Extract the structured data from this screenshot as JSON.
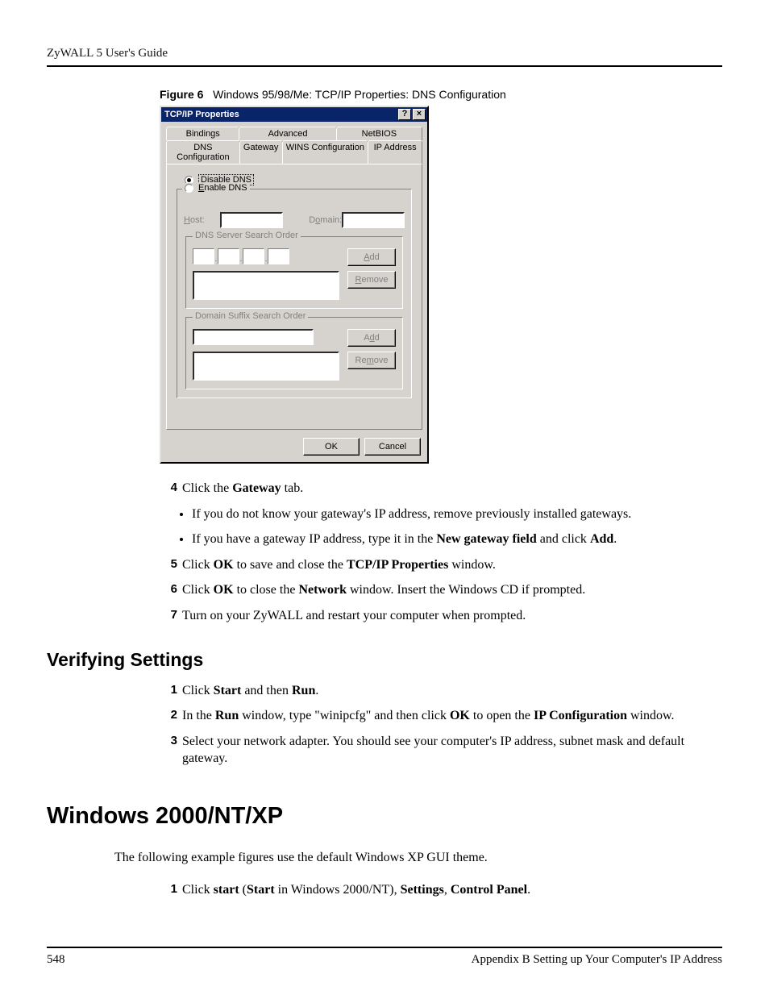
{
  "header": {
    "title": "ZyWALL 5 User's Guide"
  },
  "figure": {
    "label": "Figure 6",
    "caption": "Windows 95/98/Me: TCP/IP Properties: DNS Configuration"
  },
  "dialog": {
    "title": "TCP/IP Properties",
    "help_btn": "?",
    "close_btn": "×",
    "tabs_back": {
      "bindings": "Bindings",
      "advanced": "Advanced",
      "netbios": "NetBIOS"
    },
    "tabs_front": {
      "dns": "DNS Configuration",
      "gateway": "Gateway",
      "wins": "WINS Configuration",
      "ip": "IP Address"
    },
    "radio_disable": "Disable DNS",
    "radio_enable": "Enable DNS",
    "host_label": "Host:",
    "domain_label": "Domain:",
    "group_dns_servers": "DNS Server Search Order",
    "group_domain_suffix": "Domain Suffix Search Order",
    "btn_add": "Add",
    "btn_remove": "Remove",
    "btn_ok": "OK",
    "btn_cancel": "Cancel"
  },
  "steps1": {
    "n4": "4",
    "t4a": "Click the ",
    "t4b": "Gateway",
    "t4c": " tab.",
    "bullet1a": "If you do not know your gateway's IP address, remove previously installed gateways.",
    "bullet2a": "If you have a gateway IP address, type it in the ",
    "bullet2b": "New gateway field",
    "bullet2c": " and click ",
    "bullet2d": "Add",
    "bullet2e": ".",
    "n5": "5",
    "t5a": "Click ",
    "t5b": "OK",
    "t5c": " to save and close the ",
    "t5d": "TCP/IP Properties",
    "t5e": " window.",
    "n6": "6",
    "t6a": "Click ",
    "t6b": "OK",
    "t6c": " to close the ",
    "t6d": "Network",
    "t6e": " window. Insert the Windows CD if prompted.",
    "n7": "7",
    "t7": "Turn on your ZyWALL and restart your computer when prompted."
  },
  "section_verifying": "Verifying Settings",
  "steps2": {
    "n1": "1",
    "t1a": "Click ",
    "t1b": "Start",
    "t1c": " and then ",
    "t1d": "Run",
    "t1e": ".",
    "n2": "2",
    "t2a": "In the ",
    "t2b": "Run",
    "t2c": " window, type \"winipcfg\" and then click ",
    "t2d": "OK",
    "t2e": " to open the ",
    "t2f": "IP Configuration",
    "t2g": " window.",
    "n3": "3",
    "t3": "Select your network adapter. You should see your computer's IP address, subnet mask and default gateway."
  },
  "section_win2000": "Windows 2000/NT/XP",
  "para_win2000": "The following example figures use the default Windows XP GUI theme.",
  "steps3": {
    "n1": "1",
    "t1a": "Click ",
    "t1b": "start",
    "t1c": " (",
    "t1d": "Start",
    "t1e": " in Windows 2000/NT), ",
    "t1f": "Settings",
    "t1g": ", ",
    "t1h": "Control Panel",
    "t1i": "."
  },
  "footer": {
    "page": "548",
    "appendix": "Appendix B Setting up Your Computer's IP Address"
  }
}
